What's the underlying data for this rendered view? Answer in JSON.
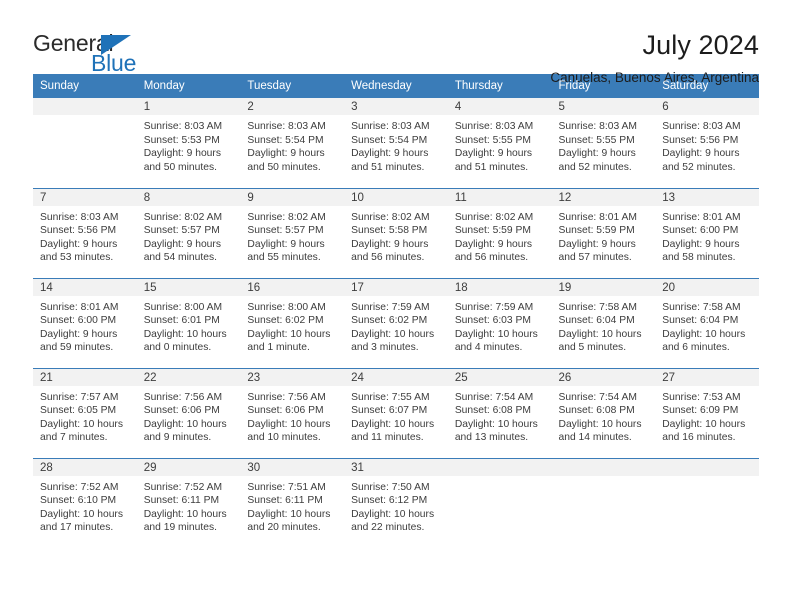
{
  "brand": {
    "name_top": "General",
    "name_bottom": "Blue",
    "triangle_icon": "blue-triangle-icon",
    "accent_color": "#1f72b8"
  },
  "header": {
    "title": "July 2024",
    "subtitle": "Canuelas, Buenos Aires, Argentina"
  },
  "theme": {
    "header_bg": "#3a7cb8",
    "daynum_bg": "#f2f2f2",
    "text": "#3d3d3d"
  },
  "weekdays": [
    "Sunday",
    "Monday",
    "Tuesday",
    "Wednesday",
    "Thursday",
    "Friday",
    "Saturday"
  ],
  "weeks": [
    [
      {
        "day": "",
        "sunrise": "",
        "sunset": "",
        "daylight1": "",
        "daylight2": ""
      },
      {
        "day": "1",
        "sunrise": "Sunrise: 8:03 AM",
        "sunset": "Sunset: 5:53 PM",
        "daylight1": "Daylight: 9 hours",
        "daylight2": "and 50 minutes."
      },
      {
        "day": "2",
        "sunrise": "Sunrise: 8:03 AM",
        "sunset": "Sunset: 5:54 PM",
        "daylight1": "Daylight: 9 hours",
        "daylight2": "and 50 minutes."
      },
      {
        "day": "3",
        "sunrise": "Sunrise: 8:03 AM",
        "sunset": "Sunset: 5:54 PM",
        "daylight1": "Daylight: 9 hours",
        "daylight2": "and 51 minutes."
      },
      {
        "day": "4",
        "sunrise": "Sunrise: 8:03 AM",
        "sunset": "Sunset: 5:55 PM",
        "daylight1": "Daylight: 9 hours",
        "daylight2": "and 51 minutes."
      },
      {
        "day": "5",
        "sunrise": "Sunrise: 8:03 AM",
        "sunset": "Sunset: 5:55 PM",
        "daylight1": "Daylight: 9 hours",
        "daylight2": "and 52 minutes."
      },
      {
        "day": "6",
        "sunrise": "Sunrise: 8:03 AM",
        "sunset": "Sunset: 5:56 PM",
        "daylight1": "Daylight: 9 hours",
        "daylight2": "and 52 minutes."
      }
    ],
    [
      {
        "day": "7",
        "sunrise": "Sunrise: 8:03 AM",
        "sunset": "Sunset: 5:56 PM",
        "daylight1": "Daylight: 9 hours",
        "daylight2": "and 53 minutes."
      },
      {
        "day": "8",
        "sunrise": "Sunrise: 8:02 AM",
        "sunset": "Sunset: 5:57 PM",
        "daylight1": "Daylight: 9 hours",
        "daylight2": "and 54 minutes."
      },
      {
        "day": "9",
        "sunrise": "Sunrise: 8:02 AM",
        "sunset": "Sunset: 5:57 PM",
        "daylight1": "Daylight: 9 hours",
        "daylight2": "and 55 minutes."
      },
      {
        "day": "10",
        "sunrise": "Sunrise: 8:02 AM",
        "sunset": "Sunset: 5:58 PM",
        "daylight1": "Daylight: 9 hours",
        "daylight2": "and 56 minutes."
      },
      {
        "day": "11",
        "sunrise": "Sunrise: 8:02 AM",
        "sunset": "Sunset: 5:59 PM",
        "daylight1": "Daylight: 9 hours",
        "daylight2": "and 56 minutes."
      },
      {
        "day": "12",
        "sunrise": "Sunrise: 8:01 AM",
        "sunset": "Sunset: 5:59 PM",
        "daylight1": "Daylight: 9 hours",
        "daylight2": "and 57 minutes."
      },
      {
        "day": "13",
        "sunrise": "Sunrise: 8:01 AM",
        "sunset": "Sunset: 6:00 PM",
        "daylight1": "Daylight: 9 hours",
        "daylight2": "and 58 minutes."
      }
    ],
    [
      {
        "day": "14",
        "sunrise": "Sunrise: 8:01 AM",
        "sunset": "Sunset: 6:00 PM",
        "daylight1": "Daylight: 9 hours",
        "daylight2": "and 59 minutes."
      },
      {
        "day": "15",
        "sunrise": "Sunrise: 8:00 AM",
        "sunset": "Sunset: 6:01 PM",
        "daylight1": "Daylight: 10 hours",
        "daylight2": "and 0 minutes."
      },
      {
        "day": "16",
        "sunrise": "Sunrise: 8:00 AM",
        "sunset": "Sunset: 6:02 PM",
        "daylight1": "Daylight: 10 hours",
        "daylight2": "and 1 minute."
      },
      {
        "day": "17",
        "sunrise": "Sunrise: 7:59 AM",
        "sunset": "Sunset: 6:02 PM",
        "daylight1": "Daylight: 10 hours",
        "daylight2": "and 3 minutes."
      },
      {
        "day": "18",
        "sunrise": "Sunrise: 7:59 AM",
        "sunset": "Sunset: 6:03 PM",
        "daylight1": "Daylight: 10 hours",
        "daylight2": "and 4 minutes."
      },
      {
        "day": "19",
        "sunrise": "Sunrise: 7:58 AM",
        "sunset": "Sunset: 6:04 PM",
        "daylight1": "Daylight: 10 hours",
        "daylight2": "and 5 minutes."
      },
      {
        "day": "20",
        "sunrise": "Sunrise: 7:58 AM",
        "sunset": "Sunset: 6:04 PM",
        "daylight1": "Daylight: 10 hours",
        "daylight2": "and 6 minutes."
      }
    ],
    [
      {
        "day": "21",
        "sunrise": "Sunrise: 7:57 AM",
        "sunset": "Sunset: 6:05 PM",
        "daylight1": "Daylight: 10 hours",
        "daylight2": "and 7 minutes."
      },
      {
        "day": "22",
        "sunrise": "Sunrise: 7:56 AM",
        "sunset": "Sunset: 6:06 PM",
        "daylight1": "Daylight: 10 hours",
        "daylight2": "and 9 minutes."
      },
      {
        "day": "23",
        "sunrise": "Sunrise: 7:56 AM",
        "sunset": "Sunset: 6:06 PM",
        "daylight1": "Daylight: 10 hours",
        "daylight2": "and 10 minutes."
      },
      {
        "day": "24",
        "sunrise": "Sunrise: 7:55 AM",
        "sunset": "Sunset: 6:07 PM",
        "daylight1": "Daylight: 10 hours",
        "daylight2": "and 11 minutes."
      },
      {
        "day": "25",
        "sunrise": "Sunrise: 7:54 AM",
        "sunset": "Sunset: 6:08 PM",
        "daylight1": "Daylight: 10 hours",
        "daylight2": "and 13 minutes."
      },
      {
        "day": "26",
        "sunrise": "Sunrise: 7:54 AM",
        "sunset": "Sunset: 6:08 PM",
        "daylight1": "Daylight: 10 hours",
        "daylight2": "and 14 minutes."
      },
      {
        "day": "27",
        "sunrise": "Sunrise: 7:53 AM",
        "sunset": "Sunset: 6:09 PM",
        "daylight1": "Daylight: 10 hours",
        "daylight2": "and 16 minutes."
      }
    ],
    [
      {
        "day": "28",
        "sunrise": "Sunrise: 7:52 AM",
        "sunset": "Sunset: 6:10 PM",
        "daylight1": "Daylight: 10 hours",
        "daylight2": "and 17 minutes."
      },
      {
        "day": "29",
        "sunrise": "Sunrise: 7:52 AM",
        "sunset": "Sunset: 6:11 PM",
        "daylight1": "Daylight: 10 hours",
        "daylight2": "and 19 minutes."
      },
      {
        "day": "30",
        "sunrise": "Sunrise: 7:51 AM",
        "sunset": "Sunset: 6:11 PM",
        "daylight1": "Daylight: 10 hours",
        "daylight2": "and 20 minutes."
      },
      {
        "day": "31",
        "sunrise": "Sunrise: 7:50 AM",
        "sunset": "Sunset: 6:12 PM",
        "daylight1": "Daylight: 10 hours",
        "daylight2": "and 22 minutes."
      },
      {
        "day": "",
        "sunrise": "",
        "sunset": "",
        "daylight1": "",
        "daylight2": ""
      },
      {
        "day": "",
        "sunrise": "",
        "sunset": "",
        "daylight1": "",
        "daylight2": ""
      },
      {
        "day": "",
        "sunrise": "",
        "sunset": "",
        "daylight1": "",
        "daylight2": ""
      }
    ]
  ]
}
